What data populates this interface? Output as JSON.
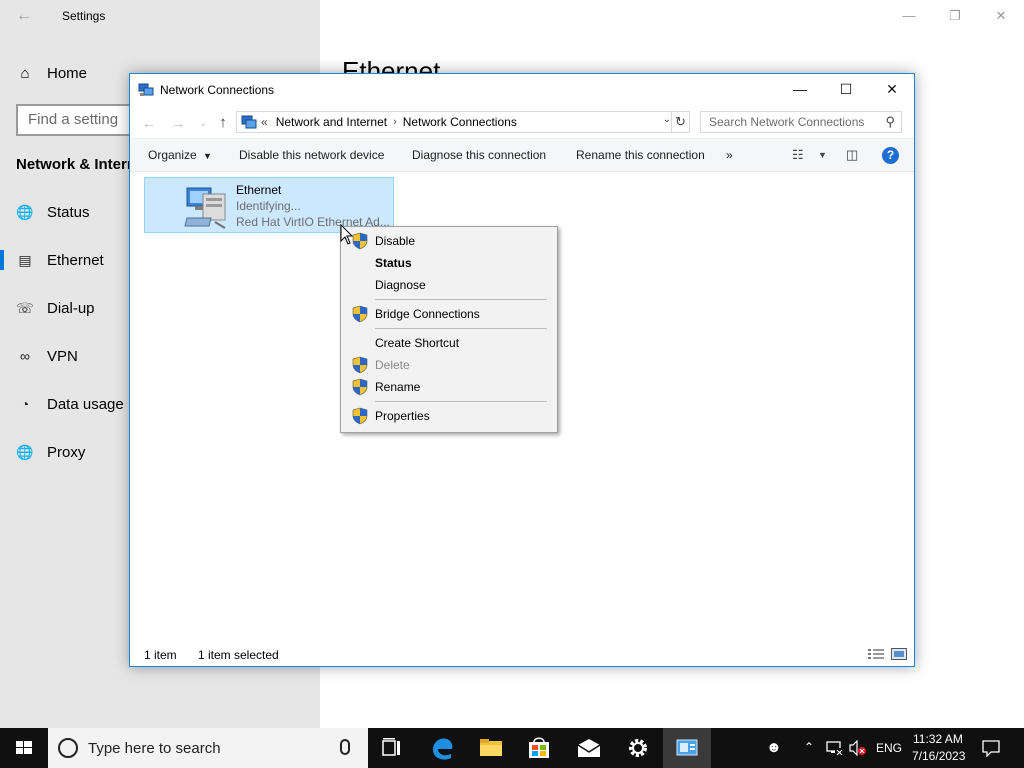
{
  "settings": {
    "window_title": "Settings",
    "home_label": "Home",
    "search_placeholder": "Find a setting",
    "section_title": "Network & Internet",
    "nav_items": [
      {
        "label": "Status",
        "icon": "globe-icon"
      },
      {
        "label": "Ethernet",
        "icon": "ethernet-icon",
        "active": true
      },
      {
        "label": "Dial-up",
        "icon": "dialup-icon"
      },
      {
        "label": "VPN",
        "icon": "vpn-icon"
      },
      {
        "label": "Data usage",
        "icon": "data-usage-icon"
      },
      {
        "label": "Proxy",
        "icon": "globe-icon"
      }
    ],
    "main_title": "Ethernet"
  },
  "explorer": {
    "title": "Network Connections",
    "breadcrumb": {
      "overflow": "«",
      "items": [
        "Network and Internet",
        "Network Connections"
      ],
      "separator": "›"
    },
    "search_placeholder": "Search Network Connections",
    "toolbar": {
      "organize": "Organize",
      "disable": "Disable this network device",
      "diagnose": "Diagnose this connection",
      "rename": "Rename this connection",
      "more": "»"
    },
    "connection": {
      "name": "Ethernet",
      "status": "Identifying...",
      "adapter": "Red Hat VirtIO Ethernet Ad..."
    },
    "status_bar": {
      "count": "1 item",
      "selected": "1 item selected"
    }
  },
  "context_menu": {
    "items": [
      {
        "label": "Disable",
        "shield": true
      },
      {
        "label": "Status",
        "bold": true
      },
      {
        "label": "Diagnose"
      },
      {
        "label": "Bridge Connections",
        "shield": true
      },
      {
        "label": "Create Shortcut"
      },
      {
        "label": "Delete",
        "shield": true,
        "disabled": true
      },
      {
        "label": "Rename",
        "shield": true
      },
      {
        "label": "Properties",
        "shield": true
      }
    ]
  },
  "taskbar": {
    "search_placeholder": "Type here to search",
    "language": "ENG",
    "time": "11:32 AM",
    "date": "7/16/2023"
  },
  "colors": {
    "accent": "#0078d7",
    "selection_bg": "#cce8ff",
    "taskbar_bg": "#101010"
  }
}
